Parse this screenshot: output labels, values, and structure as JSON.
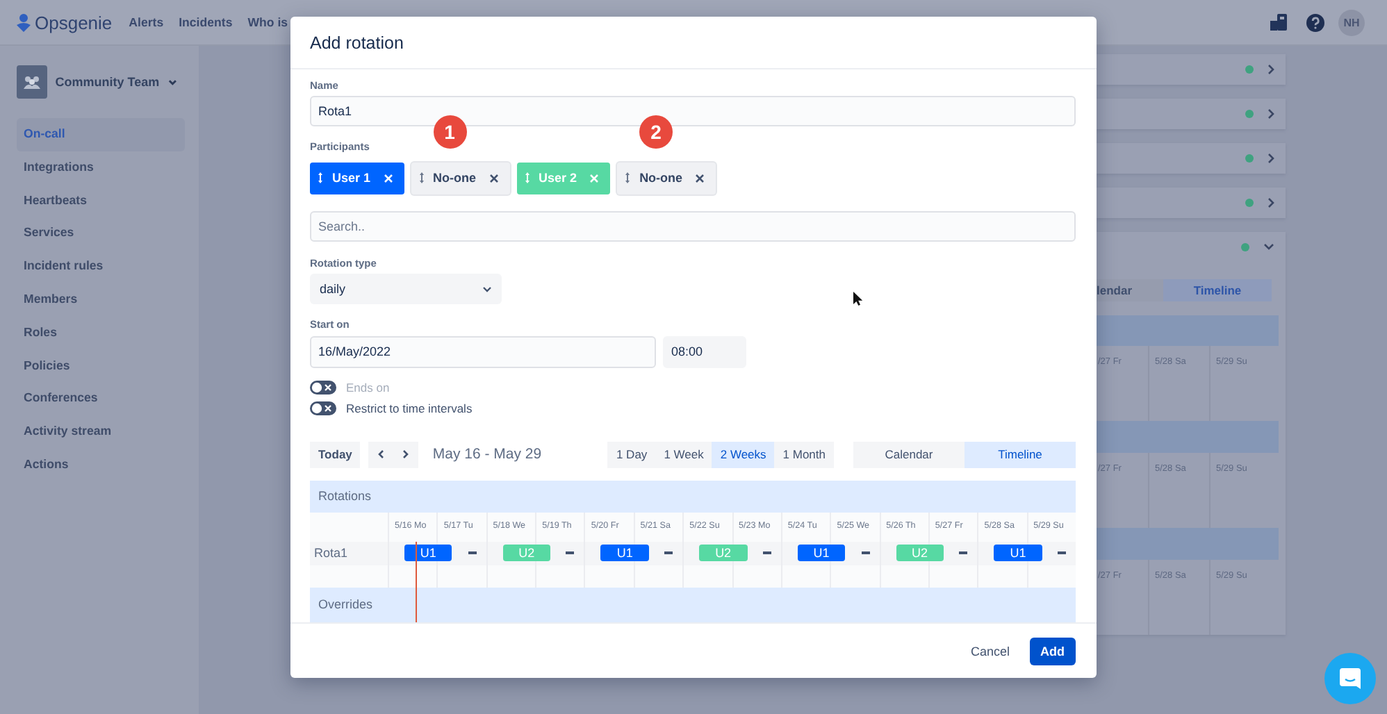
{
  "topbar": {
    "logo": "Opsgenie",
    "nav": [
      "Alerts",
      "Incidents",
      "Who is"
    ],
    "avatar": "NH"
  },
  "sidebar": {
    "team": "Community Team",
    "items": [
      {
        "label": "On-call",
        "selected": true
      },
      {
        "label": "Integrations",
        "selected": false
      },
      {
        "label": "Heartbeats",
        "selected": false
      },
      {
        "label": "Services",
        "selected": false
      },
      {
        "label": "Incident rules",
        "selected": false
      },
      {
        "label": "Members",
        "selected": false
      },
      {
        "label": "Roles",
        "selected": false
      },
      {
        "label": "Policies",
        "selected": false
      },
      {
        "label": "Conferences",
        "selected": false
      },
      {
        "label": "Activity stream",
        "selected": false
      },
      {
        "label": "Actions",
        "selected": false
      }
    ]
  },
  "background": {
    "rows": [
      {
        "expanded": false
      },
      {
        "expanded": false
      },
      {
        "expanded": false
      },
      {
        "expanded": false
      },
      {
        "expanded": true
      }
    ],
    "views": [
      {
        "label": "lendar",
        "selected": false
      },
      {
        "label": "Timeline",
        "selected": true
      }
    ],
    "sections": [
      [
        "/27 Fr",
        "5/28 Sa",
        "5/29 Su"
      ],
      [
        "/27 Fr",
        "5/28 Sa",
        "5/29 Su"
      ],
      [
        "/27 Fr",
        "5/28 Sa",
        "5/29 Su"
      ]
    ]
  },
  "modal": {
    "title": "Add rotation",
    "name_label": "Name",
    "name_value": "Rota1",
    "participants_label": "Participants",
    "participants": [
      {
        "kind": "user",
        "label": "User 1",
        "color": "#0065ff"
      },
      {
        "kind": "none",
        "label": "No-one",
        "marker": "1"
      },
      {
        "kind": "user",
        "label": "User 2",
        "color": "#57d9a3"
      },
      {
        "kind": "none",
        "label": "No-one",
        "marker": "2"
      }
    ],
    "search_placeholder": "Search..",
    "rotation_type_label": "Rotation type",
    "rotation_type_value": "daily",
    "start_label": "Start on",
    "start_date": "16/May/2022",
    "start_time": "08:00",
    "toggles": [
      {
        "label": "Ends on",
        "on": false,
        "disabled": true
      },
      {
        "label": "Restrict to time intervals",
        "on": false,
        "disabled": false
      }
    ],
    "toolbar": {
      "today": "Today",
      "range": "May 16 - May 29",
      "ranges": [
        {
          "label": "1 Day",
          "selected": false
        },
        {
          "label": "1 Week",
          "selected": false
        },
        {
          "label": "2 Weeks",
          "selected": true
        },
        {
          "label": "1 Month",
          "selected": false
        }
      ],
      "views": [
        {
          "label": "Calendar",
          "selected": false
        },
        {
          "label": "Timeline",
          "selected": true
        }
      ]
    },
    "timeline": {
      "sections": [
        "Rotations",
        "Overrides"
      ],
      "days": [
        "5/16 Mo",
        "5/17 Tu",
        "5/18 We",
        "5/19 Th",
        "5/20 Fr",
        "5/21 Sa",
        "5/22 Su",
        "5/23 Mo",
        "5/24 Tu",
        "5/25 We",
        "5/26 Th",
        "5/27 Fr",
        "5/28 Sa",
        "5/29 Su"
      ],
      "rows": [
        {
          "name": "Rota1",
          "shifts": [
            {
              "kind": "user",
              "label": "U1",
              "color": "#0065ff"
            },
            {
              "kind": "gap"
            },
            {
              "kind": "user",
              "label": "U2",
              "color": "#57d9a3"
            },
            {
              "kind": "gap"
            },
            {
              "kind": "user",
              "label": "U1",
              "color": "#0065ff"
            },
            {
              "kind": "gap"
            },
            {
              "kind": "user",
              "label": "U2",
              "color": "#57d9a3"
            },
            {
              "kind": "gap"
            },
            {
              "kind": "user",
              "label": "U1",
              "color": "#0065ff"
            },
            {
              "kind": "gap"
            },
            {
              "kind": "user",
              "label": "U2",
              "color": "#57d9a3"
            },
            {
              "kind": "gap"
            },
            {
              "kind": "user",
              "label": "U1",
              "color": "#0065ff"
            },
            {
              "kind": "gap"
            }
          ]
        }
      ]
    },
    "cancel": "Cancel",
    "submit": "Add"
  }
}
